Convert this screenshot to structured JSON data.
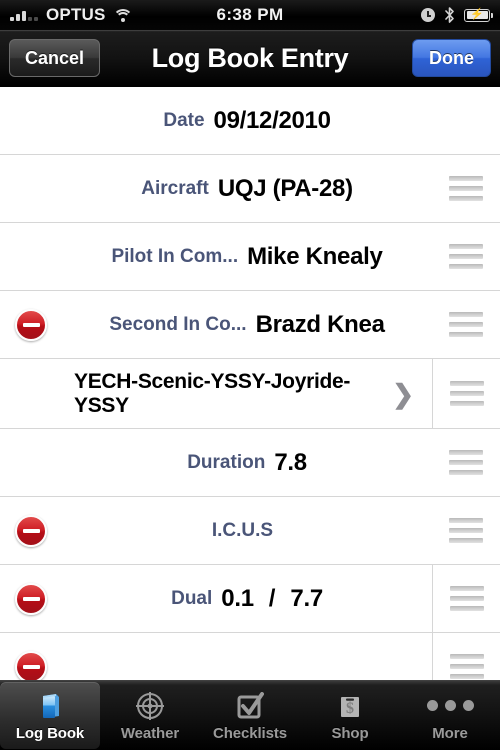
{
  "statusbar": {
    "carrier": "OPTUS",
    "time": "6:38 PM",
    "signal_icon": "signal-bars-icon",
    "wifi_icon": "wifi-icon",
    "alarm_icon": "alarm-clock-icon",
    "bluetooth_icon": "bluetooth-icon",
    "battery_icon": "battery-charging-icon"
  },
  "navbar": {
    "cancel_label": "Cancel",
    "title": "Log Book Entry",
    "done_label": "Done",
    "done_color": "#3a68d8"
  },
  "form": {
    "rows": [
      {
        "name": "date",
        "label": "Date",
        "value": "09/12/2010",
        "deletable": false,
        "handle": false,
        "chevron": false,
        "divider": false
      },
      {
        "name": "aircraft",
        "label": "Aircraft",
        "value": "UQJ (PA-28)",
        "deletable": false,
        "handle": true,
        "chevron": false,
        "divider": false
      },
      {
        "name": "pilot-in-command",
        "label": "Pilot In Com...",
        "value": "Mike Knealy",
        "deletable": false,
        "handle": true,
        "chevron": false,
        "divider": false
      },
      {
        "name": "second-in-command",
        "label": "Second In Co...",
        "value": "Brazd Knea",
        "deletable": true,
        "handle": true,
        "chevron": false,
        "divider": false
      },
      {
        "name": "route",
        "label": "",
        "value": "YECH-Scenic-YSSY-Joyride-YSSY",
        "deletable": false,
        "handle": true,
        "chevron": true,
        "divider": true
      },
      {
        "name": "duration",
        "label": "Duration",
        "value": "7.8",
        "deletable": false,
        "handle": true,
        "chevron": false,
        "divider": false
      },
      {
        "name": "icus",
        "label": "I.C.U.S",
        "value": "",
        "deletable": true,
        "handle": true,
        "chevron": false,
        "divider": false
      },
      {
        "name": "dual",
        "label": "Dual",
        "value": "0.1",
        "value2": "7.7",
        "separator": "/",
        "deletable": true,
        "handle": true,
        "chevron": false,
        "divider": true
      },
      {
        "name": "next-partial",
        "label": "",
        "value": "",
        "deletable": true,
        "handle": true,
        "chevron": false,
        "divider": true
      }
    ],
    "label_color": "#4a5578",
    "delete_icon": "delete-minus-icon",
    "handle_icon": "reorder-handle-icon",
    "chevron_icon": "chevron-right-icon"
  },
  "tabbar": {
    "tabs": [
      {
        "label": "Log Book",
        "icon": "book-icon",
        "active": true
      },
      {
        "label": "Weather",
        "icon": "radar-icon",
        "active": false
      },
      {
        "label": "Checklists",
        "icon": "checkbox-icon",
        "active": false
      },
      {
        "label": "Shop",
        "icon": "shopping-bag-dollar-icon",
        "active": false
      },
      {
        "label": "More",
        "icon": "more-dots-icon",
        "active": false
      }
    ]
  }
}
